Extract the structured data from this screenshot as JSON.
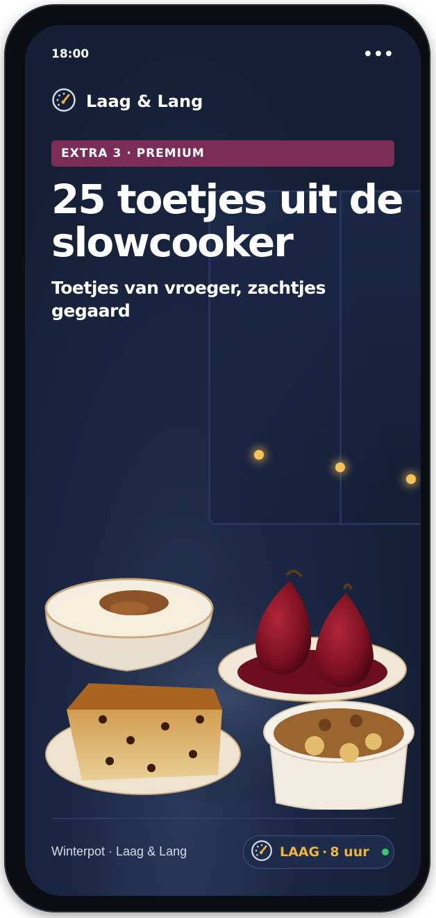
{
  "status_bar": {
    "time": "18:00",
    "menu": "•••"
  },
  "brand": {
    "name": "Laag & Lang",
    "icon": "gauge-icon"
  },
  "badge": {
    "label": "EXTRA 3 · PREMIUM",
    "color": "#7b2d58"
  },
  "hero": {
    "title": "25 toetjes uit de slowcooker",
    "subtitle": "Toetjes van vroeger, zachtjes gegaard"
  },
  "footer": {
    "caption": "Winterpot · Laag & Lang",
    "setting": {
      "level": "LAAG",
      "separator": "·",
      "duration": "8 uur",
      "status_color": "#3ec46d"
    }
  },
  "colors": {
    "background": "#152036",
    "accent": "#f1b43a"
  }
}
